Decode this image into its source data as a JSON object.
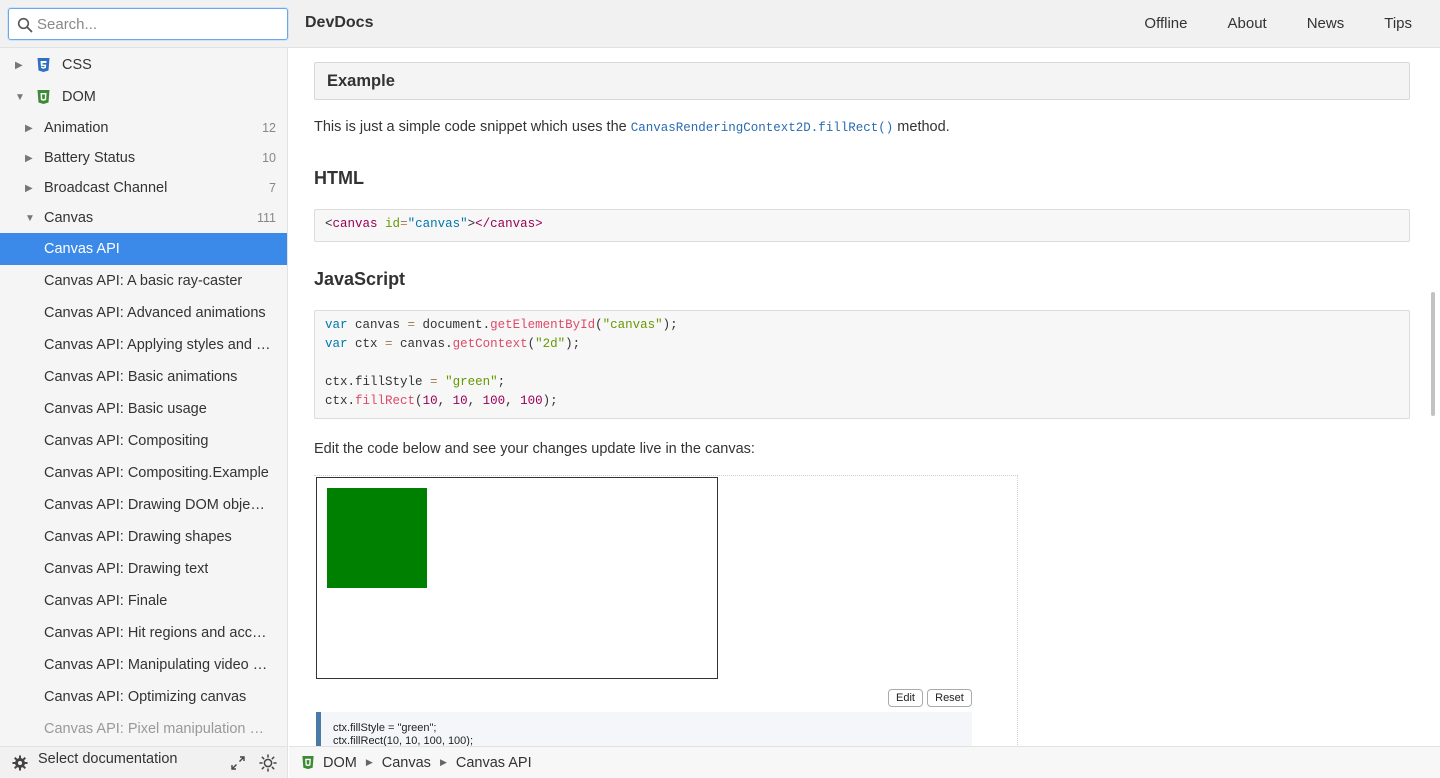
{
  "header": {
    "search_placeholder": "Search...",
    "app_title": "DevDocs",
    "nav": [
      "Offline",
      "About",
      "News",
      "Tips"
    ]
  },
  "sidebar": {
    "items": [
      {
        "label": "CSS",
        "count": "",
        "icon": "css3-icon",
        "expanded": false,
        "level": 0
      },
      {
        "label": "DOM",
        "count": "",
        "icon": "html5-icon",
        "expanded": true,
        "level": 0
      },
      {
        "label": "Animation",
        "count": "12",
        "level": 1,
        "expanded": false
      },
      {
        "label": "Battery Status",
        "count": "10",
        "level": 1,
        "expanded": false
      },
      {
        "label": "Broadcast Channel",
        "count": "7",
        "level": 1,
        "expanded": false
      },
      {
        "label": "Canvas",
        "count": "111",
        "level": 1,
        "expanded": true
      },
      {
        "label": "Canvas API",
        "count": "",
        "level": 2,
        "active": true
      },
      {
        "label": "Canvas API: A basic ray-caster",
        "count": "",
        "level": 2
      },
      {
        "label": "Canvas API: Advanced animations",
        "count": "",
        "level": 2
      },
      {
        "label": "Canvas API: Applying styles and colors",
        "count": "",
        "level": 2
      },
      {
        "label": "Canvas API: Basic animations",
        "count": "",
        "level": 2
      },
      {
        "label": "Canvas API: Basic usage",
        "count": "",
        "level": 2
      },
      {
        "label": "Canvas API: Compositing",
        "count": "",
        "level": 2
      },
      {
        "label": "Canvas API: Compositing.Example",
        "count": "",
        "level": 2
      },
      {
        "label": "Canvas API: Drawing DOM objects into a canvas",
        "count": "",
        "level": 2
      },
      {
        "label": "Canvas API: Drawing shapes",
        "count": "",
        "level": 2
      },
      {
        "label": "Canvas API: Drawing text",
        "count": "",
        "level": 2
      },
      {
        "label": "Canvas API: Finale",
        "count": "",
        "level": 2
      },
      {
        "label": "Canvas API: Hit regions and accessibility",
        "count": "",
        "level": 2
      },
      {
        "label": "Canvas API: Manipulating video using canvas",
        "count": "",
        "level": 2
      },
      {
        "label": "Canvas API: Optimizing canvas",
        "count": "",
        "level": 2
      },
      {
        "label": "Canvas API: Pixel manipulation with canvas",
        "count": "",
        "level": 2,
        "faded": true
      }
    ],
    "footer_label": "Select documentation"
  },
  "breadcrumb": [
    "DOM",
    "Canvas",
    "Canvas API"
  ],
  "content": {
    "example_heading": "Example",
    "para1_before": "This is just a simple code snippet which uses the ",
    "para1_code": "CanvasRenderingContext2D.fillRect()",
    "para1_after": " method.",
    "html_heading": "HTML",
    "html_code": {
      "lt": "<",
      "tag": "canvas",
      "attr": "id",
      "eq": "=",
      "val": "\"canvas\"",
      "gt": ">",
      "close": "</canvas>"
    },
    "js_heading": "JavaScript",
    "js_code": {
      "kw_var": "var",
      "l1_name": " canvas ",
      "eq": "=",
      "l1_obj": " document",
      "dot": ".",
      "l1_fn": "getElementById",
      "l1_arg": "\"canvas\"",
      "l2_name": " ctx ",
      "l2_obj": " canvas",
      "l2_fn": "getContext",
      "l2_arg": "\"2d\"",
      "l3_prop": "ctx",
      "l3_prop2": "fillStyle ",
      "l3_val": "\"green\"",
      "l4_fn": "fillRect",
      "n10": "10",
      "n100": "100"
    },
    "para2": "Edit the code below and see your changes update live in the canvas:",
    "canvas_fill_color": "#008000",
    "edit_label": "Edit",
    "reset_label": "Reset",
    "live_code": "ctx.fillStyle = \"green\";\nctx.fillRect(10, 10, 100, 100);"
  },
  "colors": {
    "accent": "#3b89e8",
    "green": "#008000"
  }
}
